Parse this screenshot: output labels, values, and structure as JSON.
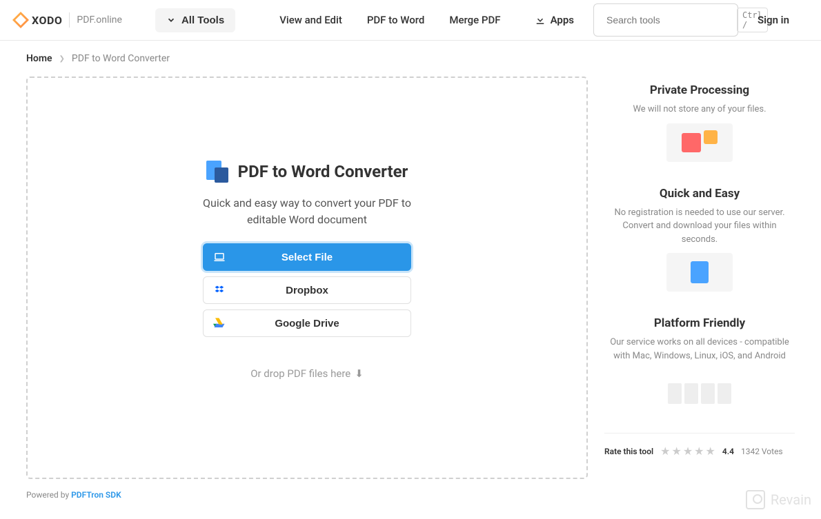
{
  "header": {
    "brand_main": "XODO",
    "brand_sub": "PDF.online",
    "all_tools": "All Tools",
    "nav": [
      "View and Edit",
      "PDF to Word",
      "Merge PDF"
    ],
    "apps": "Apps",
    "search_placeholder": "Search tools",
    "search_kbd": "Ctrl /",
    "signin": "Sign in"
  },
  "breadcrumb": {
    "home": "Home",
    "current": "PDF to Word Converter"
  },
  "tool": {
    "title": "PDF to Word Converter",
    "subtitle": "Quick and easy way to convert your PDF to editable Word document",
    "select_file": "Select File",
    "dropbox": "Dropbox",
    "gdrive": "Google Drive",
    "drop_hint": "Or drop PDF files here"
  },
  "features": [
    {
      "title": "Private Processing",
      "desc": "We will not store any of your files."
    },
    {
      "title": "Quick and Easy",
      "desc": "No registration is needed to use our server. Convert and download your files within seconds."
    },
    {
      "title": "Platform Friendly",
      "desc": "Our service works on all devices - compatible with Mac, Windows, Linux, iOS, and Android"
    }
  ],
  "rating": {
    "label": "Rate this tool",
    "score": "4.4",
    "votes": "1342 Votes"
  },
  "footer": {
    "powered": "Powered by ",
    "sdk": "PDFTron SDK"
  },
  "watermark": "Revain"
}
